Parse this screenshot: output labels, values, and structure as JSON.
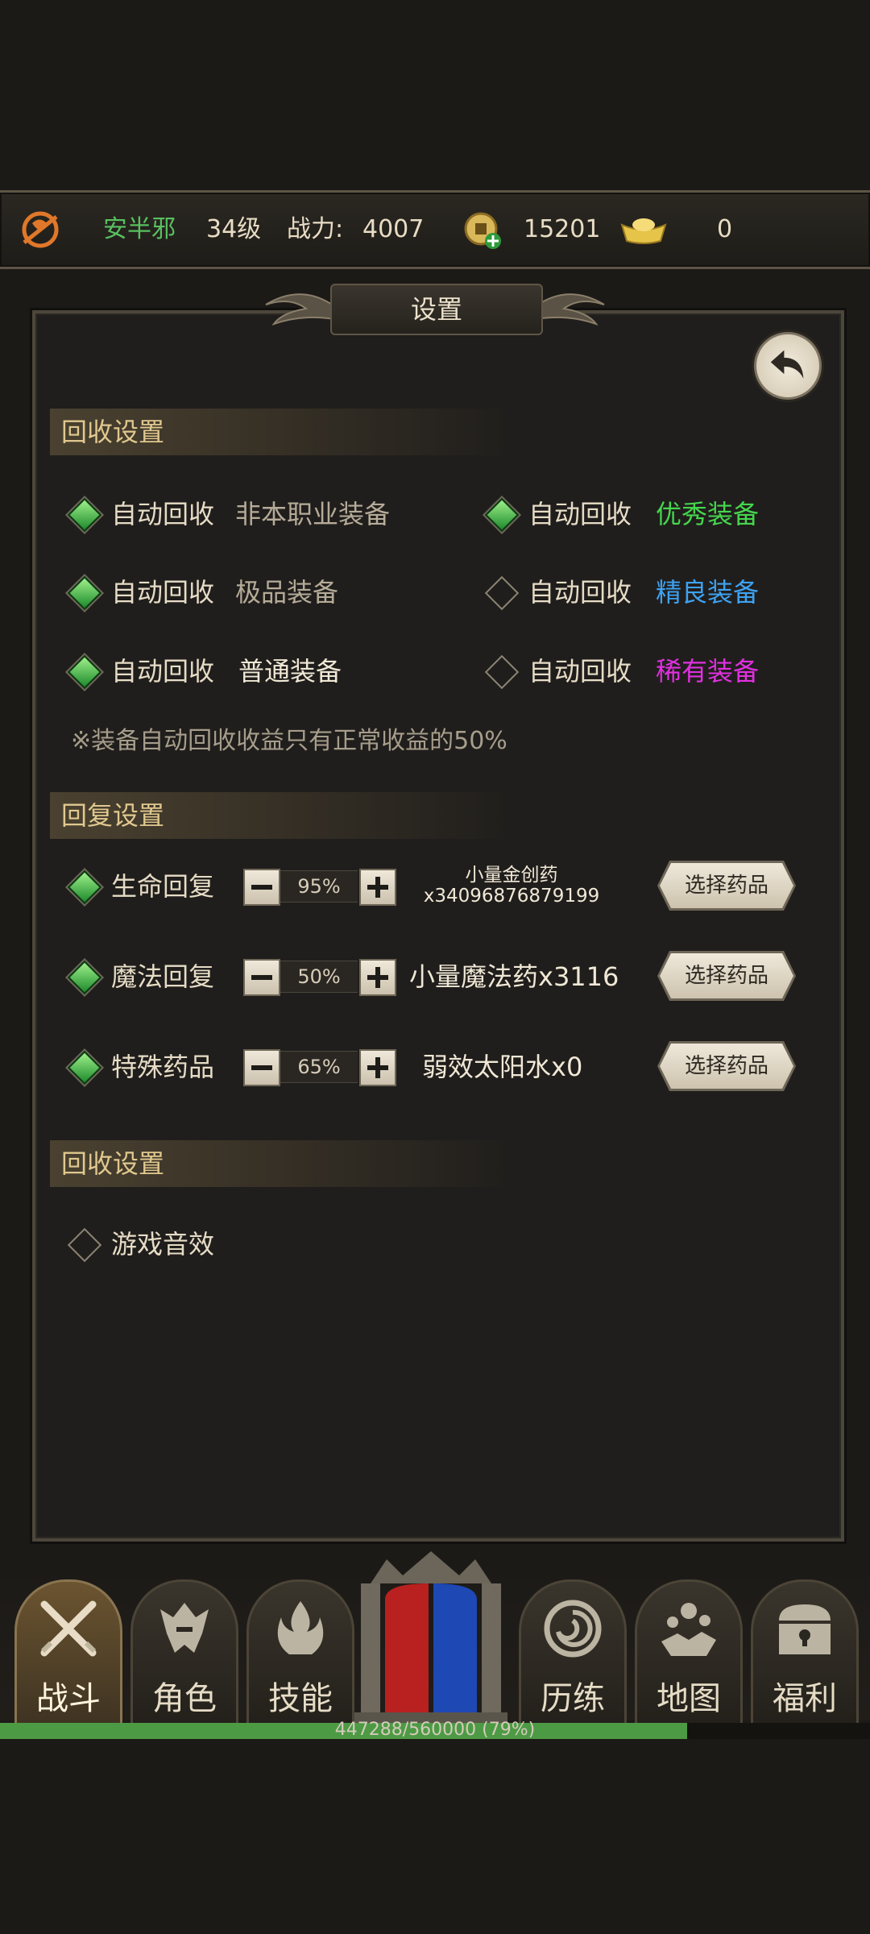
{
  "player": {
    "name": "安半邪",
    "level": "34级",
    "power_label": "战力:",
    "power_value": "4007",
    "coins": "15201",
    "ingots": "0"
  },
  "panel": {
    "title": "设置"
  },
  "recycle_section": {
    "header": "回收设置",
    "options": [
      {
        "label": "自动回收",
        "value": "非本职业装备",
        "checked": true,
        "color": "#b5ab98"
      },
      {
        "label": "自动回收",
        "value": "优秀装备",
        "checked": true,
        "color": "#45d64e"
      },
      {
        "label": "自动回收",
        "value": "极品装备",
        "checked": true,
        "color": "#b5ab98"
      },
      {
        "label": "自动回收",
        "value": "精良装备",
        "checked": false,
        "color": "#3ea2f2"
      },
      {
        "label": "自动回收",
        "value": "普通装备",
        "checked": true,
        "color": "#f0e8d6"
      },
      {
        "label": "自动回收",
        "value": "稀有装备",
        "checked": false,
        "color": "#e030e0"
      }
    ],
    "note": "※装备自动回收收益只有正常收益的50%"
  },
  "recovery_section": {
    "header": "回复设置",
    "rows": [
      {
        "label": "生命回复",
        "percent": "95%",
        "potion_line1": "小量金创药",
        "potion_line2": "x34096876879199",
        "button": "选择药品",
        "checked": true
      },
      {
        "label": "魔法回复",
        "percent": "50%",
        "potion": "小量魔法药x3116",
        "button": "选择药品",
        "checked": true
      },
      {
        "label": "特殊药品",
        "percent": "65%",
        "potion": "弱效太阳水x0",
        "button": "选择药品",
        "checked": true
      }
    ]
  },
  "sound_section": {
    "header": "回收设置",
    "option": {
      "label": "游戏音效",
      "checked": false
    }
  },
  "nav": {
    "tabs": [
      {
        "label": "战斗",
        "icon": "crossed-swords-icon",
        "active": true
      },
      {
        "label": "角色",
        "icon": "helmet-icon",
        "active": false
      },
      {
        "label": "技能",
        "icon": "flame-icon",
        "active": false
      },
      {
        "label": "历练",
        "icon": "vortex-icon",
        "active": false
      },
      {
        "label": "地图",
        "icon": "map-pins-icon",
        "active": false
      },
      {
        "label": "福利",
        "icon": "treasure-chest-icon",
        "active": false
      }
    ]
  },
  "xp": {
    "text": "447288/560000 (79%)",
    "fraction": 0.79
  },
  "colors": {
    "accent_green": "#58c060",
    "header_gold": "#e0c88f",
    "panel_bg": "#201e1c"
  }
}
